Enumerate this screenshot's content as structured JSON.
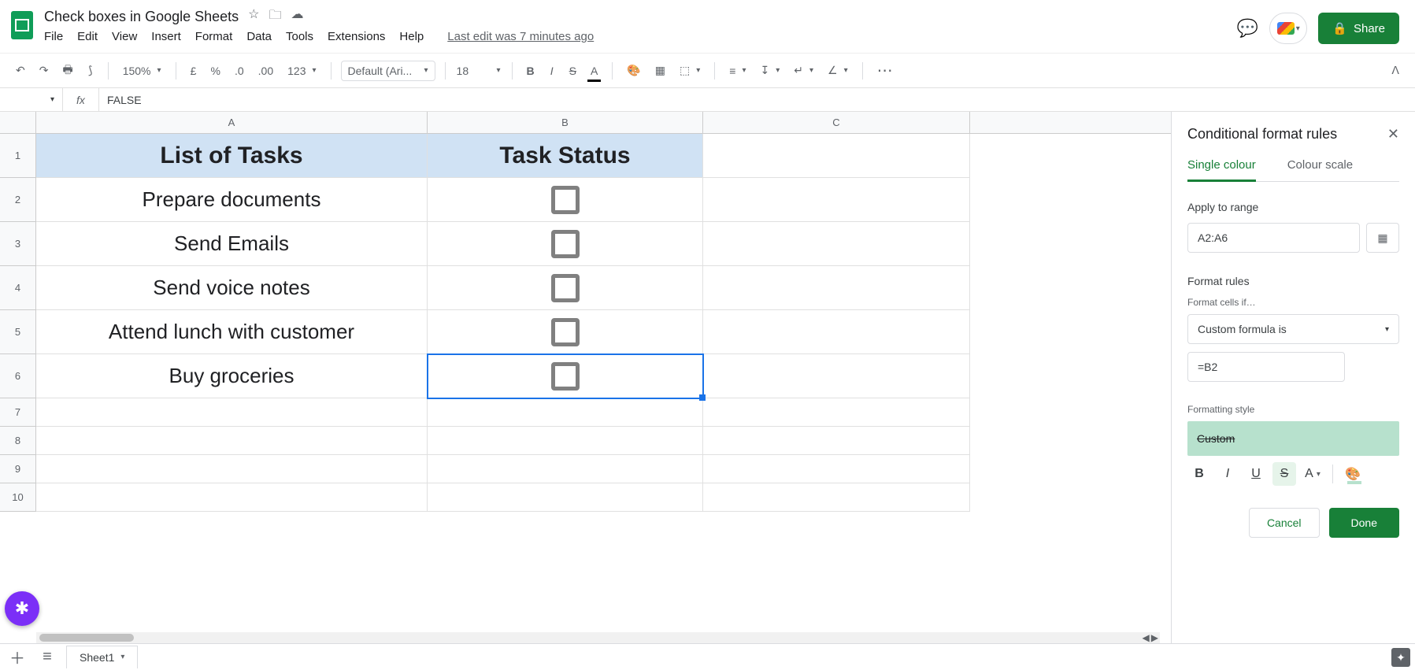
{
  "doc": {
    "title": "Check boxes in Google Sheets",
    "last_edit": "Last edit was 7 minutes ago"
  },
  "menus": [
    "File",
    "Edit",
    "View",
    "Insert",
    "Format",
    "Data",
    "Tools",
    "Extensions",
    "Help"
  ],
  "share": "Share",
  "toolbar": {
    "zoom": "150%",
    "font": "Default (Ari...",
    "size": "18",
    "formats": [
      "£",
      "%",
      ".0",
      ".00",
      "123"
    ]
  },
  "formula": {
    "value": "FALSE"
  },
  "columns": [
    "A",
    "B",
    "C"
  ],
  "rows": [
    "1",
    "2",
    "3",
    "4",
    "5",
    "6",
    "7",
    "8",
    "9",
    "10"
  ],
  "sheet": {
    "headers": {
      "A": "List of Tasks",
      "B": "Task Status"
    },
    "tasks": [
      "Prepare documents",
      "Send Emails",
      "Send voice notes",
      "Attend lunch with customer",
      "Buy groceries"
    ]
  },
  "sidebar": {
    "title": "Conditional format rules",
    "tab1": "Single colour",
    "tab2": "Colour scale",
    "apply_label": "Apply to range",
    "range": "A2:A6",
    "rules_label": "Format rules",
    "cells_if": "Format cells if…",
    "condition": "Custom formula is",
    "formula": "=B2",
    "style_label": "Formatting style",
    "style_name": "Custom",
    "cancel": "Cancel",
    "done": "Done"
  },
  "sheetbar": {
    "tab": "Sheet1"
  }
}
